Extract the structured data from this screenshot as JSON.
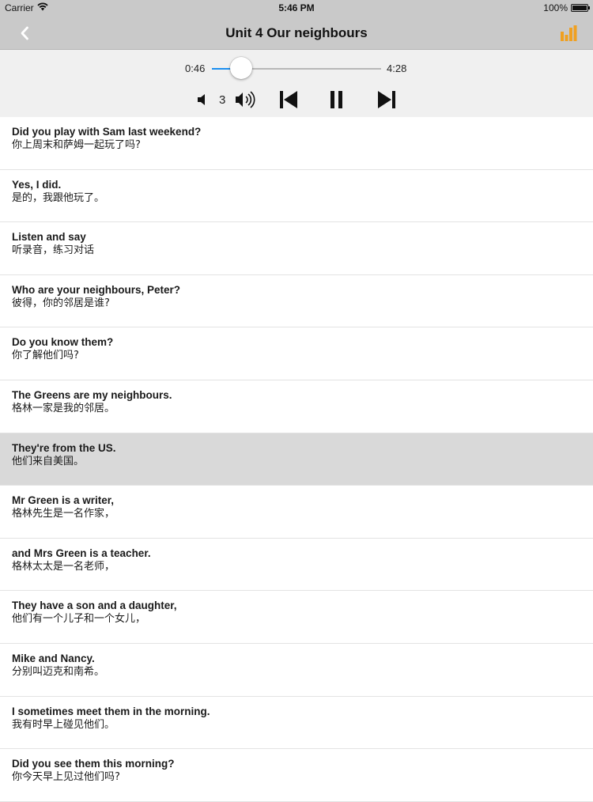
{
  "status_bar": {
    "carrier": "Carrier",
    "wifi_icon": "wifi-icon",
    "time": "5:46 PM",
    "battery": "100%"
  },
  "nav": {
    "title": "Unit 4  Our neighbours",
    "back_icon": "chevron-left-icon",
    "right_icon": "equalizer-icon",
    "accent_color": "#f0a020"
  },
  "player": {
    "current_time": "0:46",
    "total_time": "4:28",
    "progress_fraction": 0.172,
    "volume_level": "3",
    "progress_color": "#1b8ff0"
  },
  "sentences": [
    {
      "en": "Did you play with Sam last weekend?",
      "zh": "你上周末和萨姆一起玩了吗?"
    },
    {
      "en": "Yes, I did.",
      "zh": "是的，我跟他玩了。"
    },
    {
      "en": "Listen and say",
      "zh": "听录音，练习对话"
    },
    {
      "en": "Who are your neighbours, Peter?",
      "zh": "彼得，你的邻居是谁?"
    },
    {
      "en": "Do you know them?",
      "zh": "你了解他们吗?"
    },
    {
      "en": "The Greens are my neighbours.",
      "zh": "格林一家是我的邻居。"
    },
    {
      "en": "They're from the US.",
      "zh": "他们来自美国。"
    },
    {
      "en": "Mr Green is a writer,",
      "zh": "格林先生是一名作家，"
    },
    {
      "en": "and Mrs Green is a teacher.",
      "zh": "格林太太是一名老师，"
    },
    {
      "en": "They have a son and a daughter,",
      "zh": "他们有一个儿子和一个女儿，"
    },
    {
      "en": "Mike and Nancy.",
      "zh": "分别叫迈克和南希。"
    },
    {
      "en": "I sometimes meet them in the morning.",
      "zh": "我有时早上碰见他们。"
    },
    {
      "en": "Did you see them this morning?",
      "zh": "你今天早上见过他们吗?"
    }
  ],
  "active_index": 6
}
